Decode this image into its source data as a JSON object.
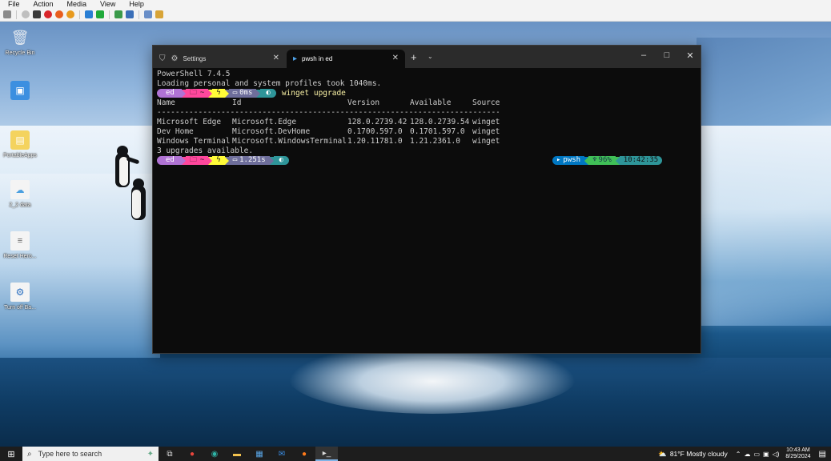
{
  "host": {
    "menu": [
      "File",
      "Action",
      "Media",
      "View",
      "Help"
    ]
  },
  "desktop": {
    "icons": [
      {
        "label": "Recycle Bin",
        "icon": "recycle-bin-icon"
      },
      {
        "label": "",
        "icon": "control-panel-icon"
      },
      {
        "label": "PortableApps",
        "icon": "portableapps-icon"
      },
      {
        "label": "2_2 data",
        "icon": "file-icon"
      },
      {
        "label": "Reset Hero...",
        "icon": "document-icon"
      },
      {
        "label": "Turn off Ba...",
        "icon": "shortcut-icon"
      }
    ]
  },
  "terminal": {
    "tabs": [
      {
        "label": "Settings",
        "icon": "gear-icon"
      },
      {
        "label": "pwsh in ed",
        "icon": "powershell-icon"
      }
    ],
    "lines": {
      "l1": "PowerShell 7.4.5",
      "l2": "Loading personal and system profiles took 1040ms."
    },
    "prompt1": {
      "user": "ed",
      "path": "~",
      "exec": "0ms",
      "command": "winget upgrade"
    },
    "table": {
      "headers": [
        "Name",
        "Id",
        "Version",
        "Available",
        "Source"
      ],
      "separator": "-------------------------------------------------------------------------------------------------",
      "rows": [
        [
          "Microsoft Edge",
          "Microsoft.Edge",
          "128.0.2739.42",
          "128.0.2739.54",
          "winget"
        ],
        [
          "Dev Home",
          "Microsoft.DevHome",
          "0.1700.597.0",
          "0.1701.597.0",
          "winget"
        ],
        [
          "Windows Terminal",
          "Microsoft.WindowsTerminal",
          "1.20.11781.0",
          "1.21.2361.0",
          "winget"
        ]
      ],
      "summary": "3 upgrades available."
    },
    "prompt2": {
      "user": "ed",
      "path": "~",
      "exec": "1.251s",
      "shell": "pwsh",
      "battery": "96%",
      "time": "10:42:35"
    }
  },
  "taskbar": {
    "search_placeholder": "Type here to search",
    "weather": "81°F  Mostly cloudy",
    "clock_time": "10:43 AM",
    "clock_date": "8/29/2024"
  },
  "colors": {
    "user_seg": "#b073d4",
    "path_seg": "#ff479c",
    "git_seg": "#fffb38",
    "exec_seg": "#6e6e9b",
    "status_seg": "#2e9599",
    "shell_seg": "#0077c2",
    "battery_seg": "#40c057"
  }
}
